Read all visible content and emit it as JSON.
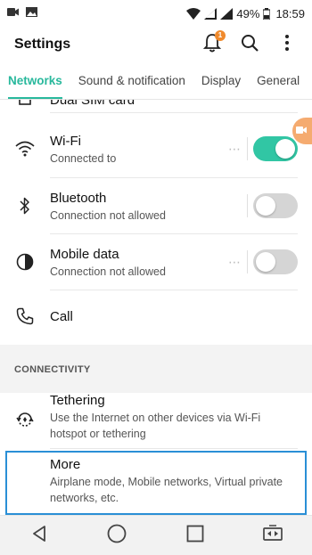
{
  "status_bar": {
    "battery": "49%",
    "time": "18:59",
    "icons": [
      "video-call-icon",
      "gallery-icon",
      "wifi-icon",
      "signal-icon",
      "signal-icon",
      "battery-icon"
    ]
  },
  "app_bar": {
    "title": "Settings",
    "notification_badge": "1"
  },
  "tabs": [
    {
      "label": "Networks",
      "active": true
    },
    {
      "label": "Sound & notification",
      "active": false
    },
    {
      "label": "Display",
      "active": false
    },
    {
      "label": "General",
      "active": false
    }
  ],
  "partial_row": {
    "label": "Dual SIM card"
  },
  "network_items": [
    {
      "name": "wifi",
      "title": "Wi-Fi",
      "subtitle": "Connected to",
      "toggle": "on",
      "icon": "wifi-icon"
    },
    {
      "name": "bluetooth",
      "title": "Bluetooth",
      "subtitle": "Connection not allowed",
      "toggle": "off",
      "icon": "bluetooth-icon"
    },
    {
      "name": "mobile-data",
      "title": "Mobile data",
      "subtitle": "Connection not allowed",
      "toggle": "off",
      "icon": "mobile-data-icon"
    },
    {
      "name": "call",
      "title": "Call",
      "icon": "phone-icon"
    }
  ],
  "section": {
    "label": "CONNECTIVITY"
  },
  "connectivity_items": [
    {
      "name": "tethering",
      "title": "Tethering",
      "subtitle": "Use the Internet on other devices via Wi-Fi hotspot or tethering",
      "icon": "tethering-icon"
    },
    {
      "name": "more",
      "title": "More",
      "subtitle": "Airplane mode, Mobile networks, Virtual private networks, etc."
    }
  ],
  "colors": {
    "accent": "#28b89c",
    "toggle_on": "#31c6a4",
    "highlight": "#2a8fd6",
    "badge": "#f08a2c"
  }
}
